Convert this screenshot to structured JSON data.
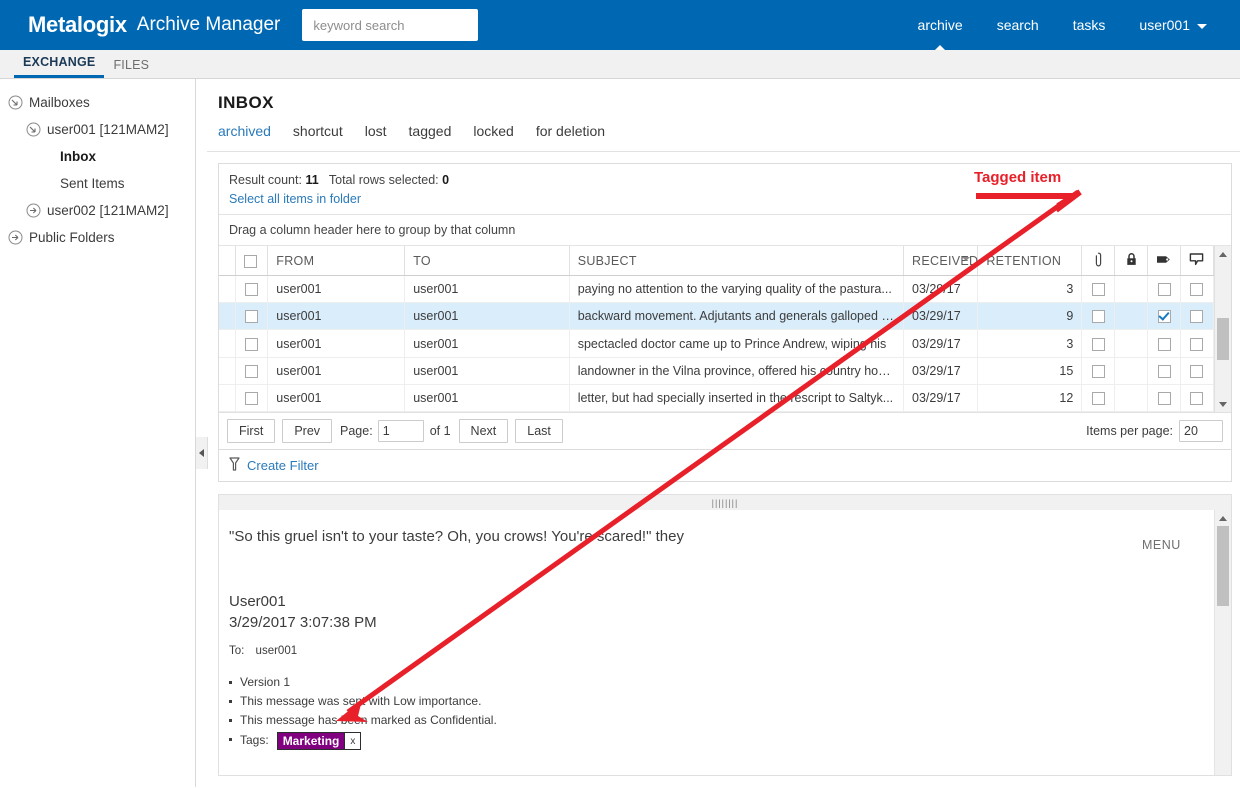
{
  "header": {
    "brand": "Metalogix",
    "app_name": "Archive Manager",
    "search_placeholder": "keyword search",
    "nav": [
      {
        "label": "archive",
        "active": true
      },
      {
        "label": "search",
        "active": false
      },
      {
        "label": "tasks",
        "active": false
      }
    ],
    "user": "user001"
  },
  "module_tabs": [
    {
      "label": "EXCHANGE",
      "active": true
    },
    {
      "label": "FILES",
      "active": false
    }
  ],
  "sidebar": {
    "items": [
      {
        "label": "Mailboxes",
        "level": 0,
        "icon": "expanded-node-icon",
        "bold": false
      },
      {
        "label": "user001 [121MAM2]",
        "level": 1,
        "icon": "expanded-node-icon",
        "bold": false
      },
      {
        "label": "Inbox",
        "level": 2,
        "icon": "none",
        "bold": true
      },
      {
        "label": "Sent Items",
        "level": 2,
        "icon": "none",
        "bold": false
      },
      {
        "label": "user002 [121MAM2]",
        "level": 1,
        "icon": "collapsed-node-icon",
        "bold": false
      },
      {
        "label": "Public Folders",
        "level": 0,
        "icon": "collapsed-node-icon",
        "bold": false
      }
    ]
  },
  "folder": {
    "title": "INBOX",
    "subtabs": [
      {
        "label": "archived",
        "active": true
      },
      {
        "label": "shortcut",
        "active": false
      },
      {
        "label": "lost",
        "active": false
      },
      {
        "label": "tagged",
        "active": false
      },
      {
        "label": "locked",
        "active": false
      },
      {
        "label": "for deletion",
        "active": false
      }
    ]
  },
  "results": {
    "result_count_label": "Result count:",
    "result_count": "11",
    "total_rows_label": "Total rows selected:",
    "total_rows": "0",
    "select_all_link": "Select all items in folder",
    "group_hint": "Drag a column header here to group by that column"
  },
  "grid": {
    "columns": [
      {
        "label": "FROM",
        "key": "from"
      },
      {
        "label": "TO",
        "key": "to"
      },
      {
        "label": "SUBJECT",
        "key": "subject"
      },
      {
        "label": "RECEIVED",
        "key": "received",
        "sorted": true
      },
      {
        "label": "RETENTION",
        "key": "retention"
      }
    ],
    "icon_columns": [
      {
        "icon": "paperclip-icon",
        "name": "attachment-column"
      },
      {
        "icon": "lock-icon",
        "name": "lock-column"
      },
      {
        "icon": "tag-icon",
        "name": "tag-column"
      },
      {
        "icon": "comment-icon",
        "name": "comment-column"
      }
    ],
    "rows": [
      {
        "selected_cb": false,
        "from": "user001",
        "to": "user001",
        "subject": "paying no attention to the varying quality of the pastura...",
        "received": "03/29/17",
        "retention": "3",
        "attachment": false,
        "tag": false,
        "comment": false,
        "highlighted": false
      },
      {
        "selected_cb": false,
        "from": "user001",
        "to": "user001",
        "subject": "backward movement. Adjutants and generals galloped a...",
        "received": "03/29/17",
        "retention": "9",
        "attachment": false,
        "tag": true,
        "comment": false,
        "highlighted": true
      },
      {
        "selected_cb": false,
        "from": "user001",
        "to": "user001",
        "subject": "spectacled doctor came up to Prince Andrew, wiping his",
        "received": "03/29/17",
        "retention": "3",
        "attachment": false,
        "tag": false,
        "comment": false,
        "highlighted": false
      },
      {
        "selected_cb": false,
        "from": "user001",
        "to": "user001",
        "subject": "landowner in the Vilna province, offered his country hou...",
        "received": "03/29/17",
        "retention": "15",
        "attachment": false,
        "tag": false,
        "comment": false,
        "highlighted": false
      },
      {
        "selected_cb": false,
        "from": "user001",
        "to": "user001",
        "subject": "letter, but had specially inserted in the rescript to Saltyk...",
        "received": "03/29/17",
        "retention": "12",
        "attachment": false,
        "tag": false,
        "comment": false,
        "highlighted": false
      }
    ]
  },
  "pager": {
    "first": "First",
    "prev": "Prev",
    "page_label": "Page:",
    "page_value": "1",
    "of_label": "of 1",
    "next": "Next",
    "last": "Last",
    "items_per_page_label": "Items per page:",
    "items_per_page_value": "20"
  },
  "filter": {
    "create_filter": "Create Filter"
  },
  "preview": {
    "subject": "\"So this gruel isn't to your taste? Oh, you crows! You're scared!\" they",
    "from": "User001",
    "date": "3/29/2017 3:07:38 PM",
    "to_label": "To:",
    "to_value": "user001",
    "properties": [
      "Version  1",
      "This message was sent with Low importance.",
      "This message has been marked as Confidential."
    ],
    "tags_label": "Tags:",
    "tag_name": "Marketing",
    "tag_remove": "x",
    "menu_label": "MENU"
  },
  "annotations": {
    "tagged_item": "Tagged item",
    "color": "#e8202a"
  }
}
